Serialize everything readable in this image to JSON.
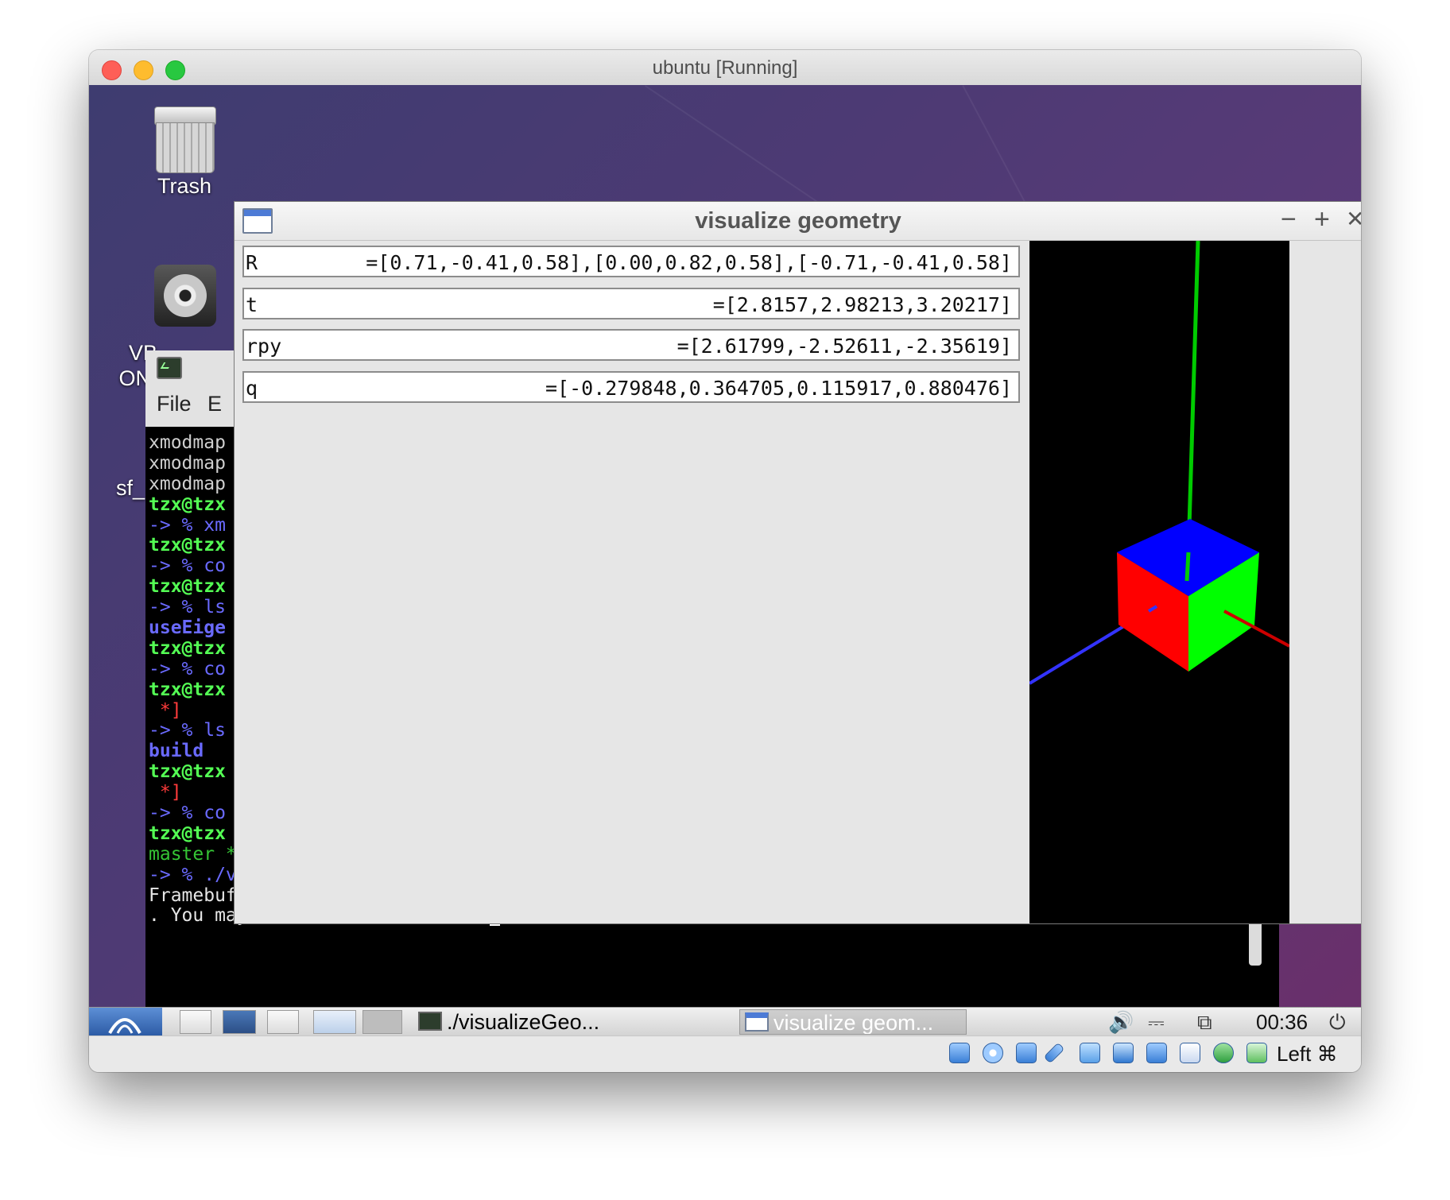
{
  "window": {
    "title": "ubuntu [Running]"
  },
  "desktop": {
    "trash_label": "Trash",
    "vbox_label_line1": "VB",
    "vbox_label_line2": "ON",
    "share_label": "sf_"
  },
  "terminal": {
    "menu_file": "File",
    "menu_edit": "E",
    "lines": [
      {
        "text": "xmodmap",
        "style": "gray"
      },
      {
        "text": "xmodmap",
        "style": "gray"
      },
      {
        "text": "xmodmap",
        "style": "gray"
      },
      {
        "text": "tzx@tzx",
        "style": "green"
      },
      {
        "text": "-> % xm",
        "style": "blue"
      },
      {
        "text": "tzx@tzx",
        "style": "green"
      },
      {
        "text": "-> % co",
        "style": "blue"
      },
      {
        "text": "tzx@tzx",
        "style": "green"
      },
      {
        "text": "-> % ls",
        "style": "blue"
      },
      {
        "text": "useEige",
        "style": "blue-b"
      },
      {
        "text": "tzx@tzx",
        "style": "green"
      },
      {
        "text": "-> % co",
        "style": "blue"
      },
      {
        "text": "tzx@tzx",
        "style": "green"
      },
      {
        "text": " *]",
        "style": "red"
      },
      {
        "text": "-> % ls",
        "style": "blue"
      },
      {
        "text": "build",
        "style": "blue-b"
      },
      {
        "text": "tzx@tzx",
        "style": "green"
      },
      {
        "text": " *]",
        "style": "red"
      },
      {
        "text": "-> % co",
        "style": "blue"
      },
      {
        "text": "tzx@tzx",
        "style": "green"
      },
      {
        "text": "master *]",
        "style": "dkgreen"
      },
      {
        "text": "-> % ./visualizeGeometry",
        "style": "blue"
      },
      {
        "text": "Framebuffer with requested attributes not available. Using available framebuffer",
        "style": "white"
      },
      {
        "text": ". You may see visual artifacts.",
        "style": "white"
      }
    ]
  },
  "viz": {
    "title": "visualize geometry",
    "minimize": "−",
    "maximize": "+",
    "close": "✕",
    "fields": [
      {
        "label": "R",
        "value": "=[0.71,-0.41,0.58],[0.00,0.82,0.58],[-0.71,-0.41,0.58]"
      },
      {
        "label": "t",
        "value": "=[2.8157,2.98213,3.20217]"
      },
      {
        "label": "rpy",
        "value": "=[2.61799,-2.52611,-2.35619]"
      },
      {
        "label": "q",
        "value": "=[-0.279848,0.364705,0.115917,0.880476]"
      }
    ],
    "colors": {
      "face_top": "#0000ff",
      "face_left": "#ff0000",
      "face_right": "#00ff00",
      "axis_z": "#00cc00",
      "axis_x": "#cc0000",
      "axis_y": "#3333ff"
    }
  },
  "taskbar": {
    "task1": "./visualizeGeo...",
    "task2": "visualize geom...",
    "clock": "00:36"
  },
  "statusbar": {
    "host_key": "Left ⌘"
  }
}
